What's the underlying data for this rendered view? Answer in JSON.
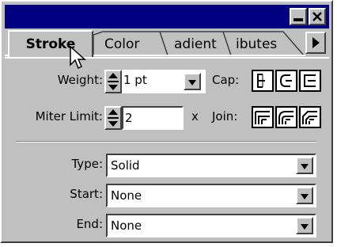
{
  "tabs": [
    {
      "label": "Stroke",
      "active": true
    },
    {
      "label": "Color"
    },
    {
      "label": "adient"
    },
    {
      "label": "ibutes"
    }
  ],
  "weight": {
    "label": "Weight:",
    "value": "1 pt"
  },
  "cap": {
    "label": "Cap:",
    "options": [
      "butt-cap-icon",
      "round-cap-icon",
      "projecting-cap-icon"
    ]
  },
  "miter": {
    "label": "Miter Limit:",
    "value": "2",
    "suffix": "x"
  },
  "join": {
    "label": "Join:",
    "options": [
      "miter-join-icon",
      "round-join-icon",
      "bevel-join-icon"
    ]
  },
  "type": {
    "label": "Type:",
    "value": "Solid"
  },
  "start": {
    "label": "Start:",
    "value": "None"
  },
  "end": {
    "label": "End:",
    "value": "None"
  },
  "colors": {
    "titlebar": "#000080",
    "panel": "#c0c0c0"
  }
}
